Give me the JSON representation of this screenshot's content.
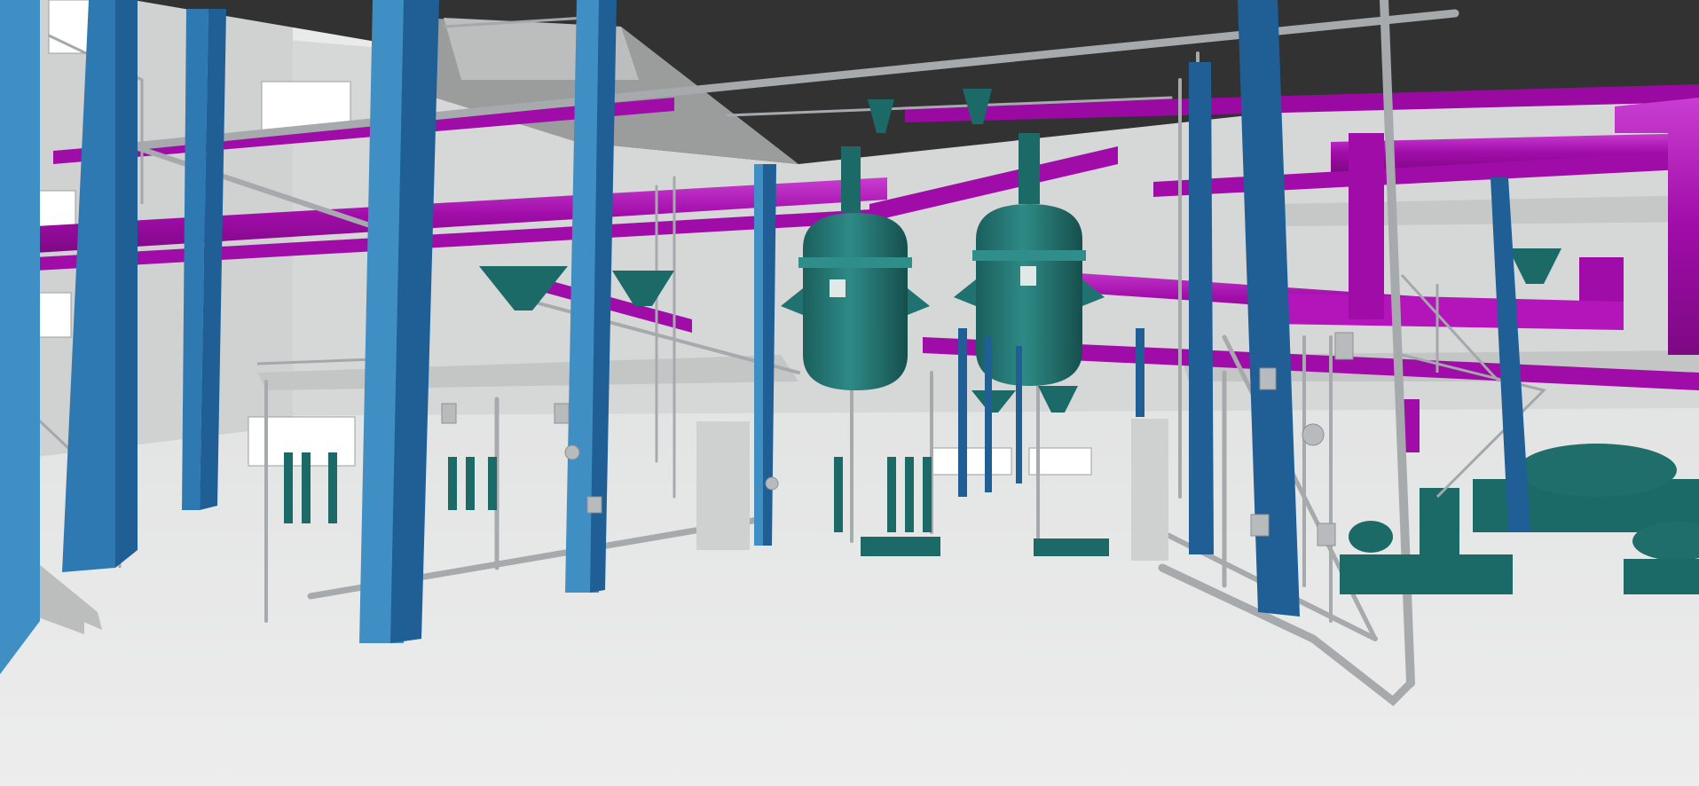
{
  "scene": {
    "kind": "3d-plant-render",
    "colors": {
      "ceiling": "#323232",
      "floor": "#e9eaea",
      "back_wall": "#d8d9d9",
      "column_light": "#3f8fc4",
      "column_dark": "#1f5f95",
      "pipe_magenta": "#a00ca8",
      "pipe_magenta_light": "#c21ccc",
      "pipe_gray": "#a7aaad",
      "equipment_teal": "#1c6a68",
      "equipment_teal_light": "#2a8582",
      "platform": "#c9caca",
      "window": "#ffffff"
    }
  }
}
